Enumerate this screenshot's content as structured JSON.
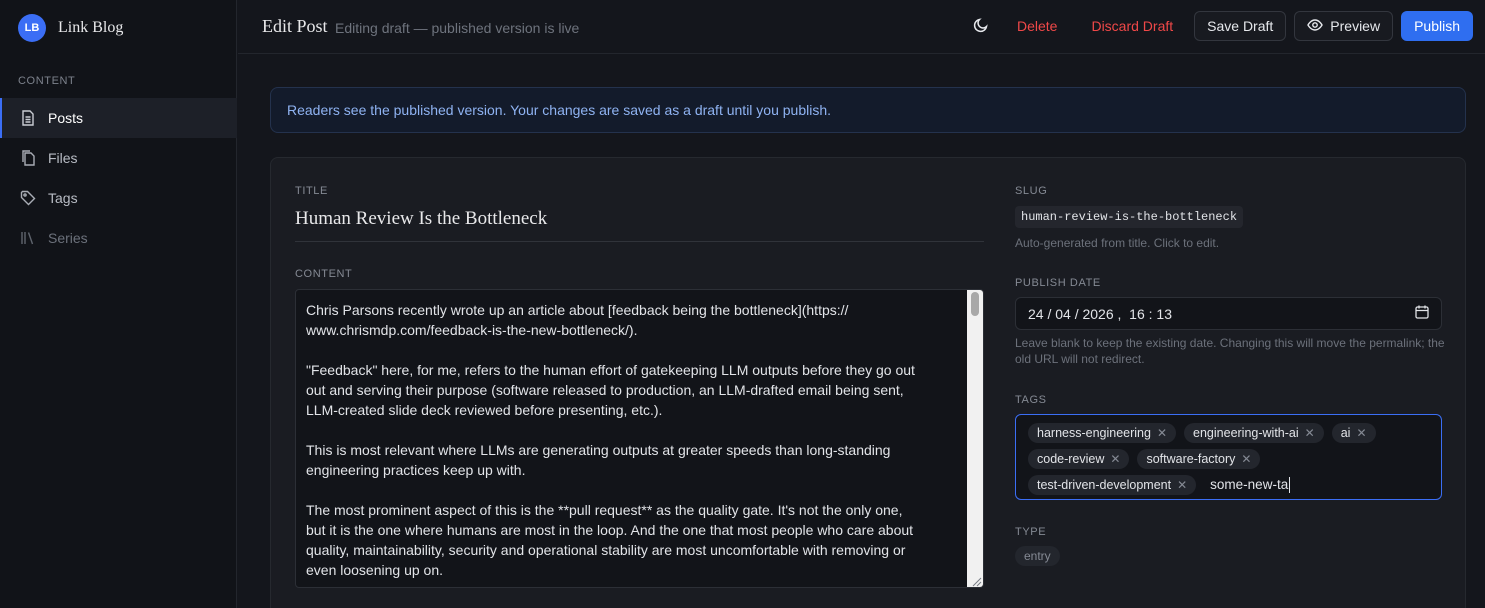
{
  "app": {
    "logo_initials": "LB",
    "name": "Link Blog"
  },
  "sidebar": {
    "section_label": "CONTENT",
    "items": [
      {
        "label": "Posts",
        "icon": "document-icon",
        "active": true
      },
      {
        "label": "Files",
        "icon": "files-icon",
        "active": false
      },
      {
        "label": "Tags",
        "icon": "tag-icon",
        "active": false
      },
      {
        "label": "Series",
        "icon": "library-icon",
        "active": false
      }
    ]
  },
  "header": {
    "title": "Edit Post",
    "subtitle": "Editing draft — published version is live",
    "theme_icon": "moon-icon",
    "delete_label": "Delete",
    "discard_label": "Discard Draft",
    "save_label": "Save Draft",
    "preview_label": "Preview",
    "preview_icon": "eye-icon",
    "publish_label": "Publish"
  },
  "banner": {
    "text": "Readers see the published version. Your changes are saved as a draft until you publish."
  },
  "editor": {
    "title_label": "TITLE",
    "title_value": "Human Review Is the Bottleneck",
    "content_label": "CONTENT",
    "content_value": "Chris Parsons recently wrote up an article about [feedback being the bottleneck](https://\nwww.chrismdp.com/feedback-is-the-new-bottleneck/).\n\n\"Feedback\" here, for me, refers to the human effort of gatekeeping LLM outputs before they go out\nout and serving their purpose (software released to production, an LLM-drafted email being sent,\nLLM-created slide deck reviewed before presenting, etc.).\n\nThis is most relevant where LLMs are generating outputs at greater speeds than long-standing\nengineering practices keep up with.\n\nThe most prominent aspect of this is the **pull request** as the quality gate. It's not the only one,\nbut it is the one where humans are most in the loop. And the one that most people who care about\nquality, maintainability, security and operational stability are most uncomfortable with removing or\neven loosening up on."
  },
  "meta": {
    "slug_label": "SLUG",
    "slug_value": "human-review-is-the-bottleneck",
    "slug_help": "Auto-generated from title. Click to edit.",
    "date_label": "PUBLISH DATE",
    "date_value": "24 / 04 / 2026 ,  16 : 13",
    "date_help": "Leave blank to keep the existing date. Changing this will move the permalink; the old URL will not redirect.",
    "tags_label": "TAGS",
    "tags_row1": [
      "harness-engineering",
      "engineering-with-ai",
      "ai"
    ],
    "tags_row2": [
      "code-review",
      "software-factory"
    ],
    "tags_row3": [
      "test-driven-development"
    ],
    "tag_input_value": "some-new-ta",
    "type_label": "TYPE",
    "type_value": "entry"
  },
  "colors": {
    "accent": "#2f6ef0",
    "danger": "#f04848",
    "background": "#14161c"
  }
}
